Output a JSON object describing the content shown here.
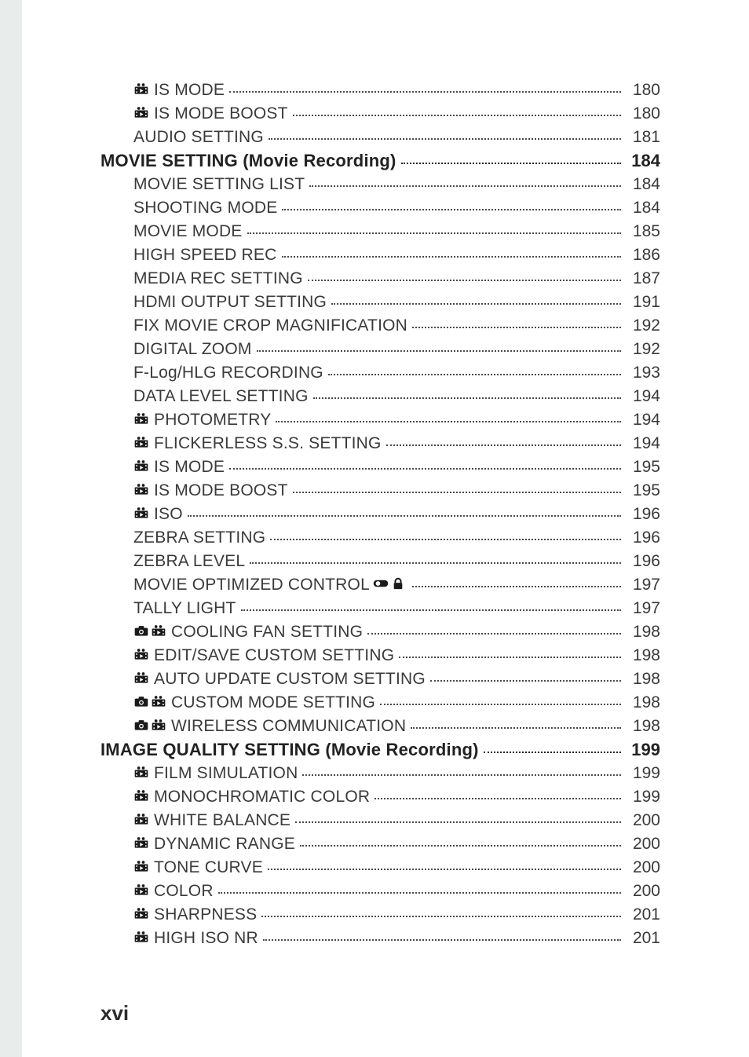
{
  "footer": "xvi",
  "entries": [
    {
      "indent": 2,
      "icons": [
        "movie"
      ],
      "label": "IS MODE",
      "page": "180"
    },
    {
      "indent": 2,
      "icons": [
        "movie"
      ],
      "label": "IS MODE BOOST",
      "page": "180"
    },
    {
      "indent": 2,
      "icons": [],
      "label": "AUDIO SETTING",
      "page": "181"
    },
    {
      "indent": 1,
      "section": true,
      "icons": [],
      "label": "MOVIE SETTING (Movie Recording)",
      "page": "184"
    },
    {
      "indent": 2,
      "icons": [],
      "label": "MOVIE SETTING LIST",
      "page": "184"
    },
    {
      "indent": 2,
      "icons": [],
      "label": "SHOOTING MODE",
      "page": "184"
    },
    {
      "indent": 2,
      "icons": [],
      "label": "MOVIE MODE",
      "page": "185"
    },
    {
      "indent": 2,
      "icons": [],
      "label": "HIGH SPEED REC",
      "page": "186"
    },
    {
      "indent": 2,
      "icons": [],
      "label": "MEDIA REC SETTING",
      "page": "187"
    },
    {
      "indent": 2,
      "icons": [],
      "label": "HDMI OUTPUT SETTING",
      "page": "191"
    },
    {
      "indent": 2,
      "icons": [],
      "label": "FIX MOVIE CROP MAGNIFICATION ",
      "page": "192"
    },
    {
      "indent": 2,
      "icons": [],
      "label": "DIGITAL ZOOM",
      "page": "192"
    },
    {
      "indent": 2,
      "icons": [],
      "label": "F-Log/HLG RECORDING ",
      "page": "193"
    },
    {
      "indent": 2,
      "icons": [],
      "label": "DATA LEVEL SETTING ",
      "page": "194"
    },
    {
      "indent": 2,
      "icons": [
        "movie"
      ],
      "label": "PHOTOMETRY ",
      "page": "194"
    },
    {
      "indent": 2,
      "icons": [
        "movie"
      ],
      "label": "FLICKERLESS S.S. SETTING",
      "page": "194"
    },
    {
      "indent": 2,
      "icons": [
        "movie"
      ],
      "label": "IS MODE",
      "page": "195"
    },
    {
      "indent": 2,
      "icons": [
        "movie"
      ],
      "label": "IS MODE BOOST",
      "page": "195"
    },
    {
      "indent": 2,
      "icons": [
        "movie"
      ],
      "label": "ISO",
      "page": "196"
    },
    {
      "indent": 2,
      "icons": [],
      "label": "ZEBRA SETTING ",
      "page": "196"
    },
    {
      "indent": 2,
      "icons": [],
      "label": "ZEBRA LEVEL ",
      "page": "196"
    },
    {
      "indent": 2,
      "icons": [],
      "label": "MOVIE OPTIMIZED CONTROL ",
      "trail_icons": [
        "toggle",
        "lock"
      ],
      "page": "197"
    },
    {
      "indent": 2,
      "icons": [],
      "label": "TALLY LIGHT",
      "page": "197"
    },
    {
      "indent": 2,
      "icons": [
        "camera",
        "movie"
      ],
      "label": "COOLING FAN SETTING",
      "page": "198"
    },
    {
      "indent": 2,
      "icons": [
        "movie"
      ],
      "label": "EDIT/SAVE CUSTOM SETTING",
      "page": "198"
    },
    {
      "indent": 2,
      "icons": [
        "movie"
      ],
      "label": "AUTO UPDATE CUSTOM SETTING ",
      "page": "198"
    },
    {
      "indent": 2,
      "icons": [
        "camera",
        "movie"
      ],
      "label": "CUSTOM MODE SETTING",
      "page": "198"
    },
    {
      "indent": 2,
      "icons": [
        "camera",
        "movie"
      ],
      "label": "WIRELESS COMMUNICATION",
      "page": "198"
    },
    {
      "indent": 1,
      "section": true,
      "icons": [],
      "label": "IMAGE QUALITY SETTING (Movie Recording) ",
      "page": "199"
    },
    {
      "indent": 2,
      "icons": [
        "movie"
      ],
      "label": "FILM SIMULATION",
      "page": "199"
    },
    {
      "indent": 2,
      "icons": [
        "movie"
      ],
      "label": "MONOCHROMATIC COLOR ",
      "page": "199"
    },
    {
      "indent": 2,
      "icons": [
        "movie"
      ],
      "label": "WHITE BALANCE",
      "page": "200"
    },
    {
      "indent": 2,
      "icons": [
        "movie"
      ],
      "label": "DYNAMIC RANGE",
      "page": "200"
    },
    {
      "indent": 2,
      "icons": [
        "movie"
      ],
      "label": "TONE CURVE ",
      "page": "200"
    },
    {
      "indent": 2,
      "icons": [
        "movie"
      ],
      "label": "COLOR",
      "page": "200"
    },
    {
      "indent": 2,
      "icons": [
        "movie"
      ],
      "label": "SHARPNESS",
      "page": "201"
    },
    {
      "indent": 2,
      "icons": [
        "movie"
      ],
      "label": "HIGH ISO NR",
      "page": "201"
    }
  ],
  "icon_names": {
    "movie": "movie-icon",
    "camera": "camera-icon",
    "toggle": "toggle-icon",
    "lock": "lock-icon"
  }
}
